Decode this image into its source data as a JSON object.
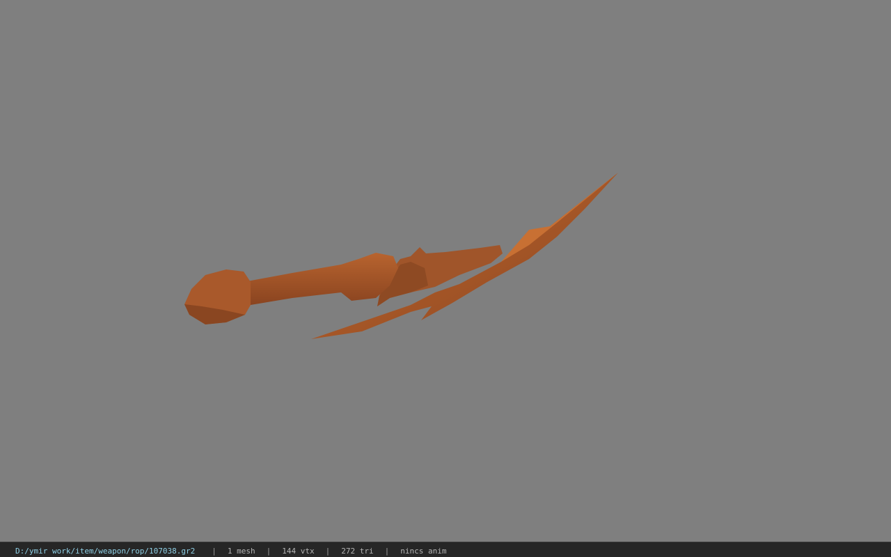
{
  "status_bar": {
    "file_path": "D:/ymir work/item/weapon/rop/107038.gr2",
    "separator": "|",
    "mesh_count": "1 mesh",
    "vertex_count": "144 vtx",
    "triangle_count": "272 tri",
    "anim_status": "nincs anim"
  },
  "viewport": {
    "background_color": "#7f7f7f",
    "model_color": "#a85a2c"
  }
}
